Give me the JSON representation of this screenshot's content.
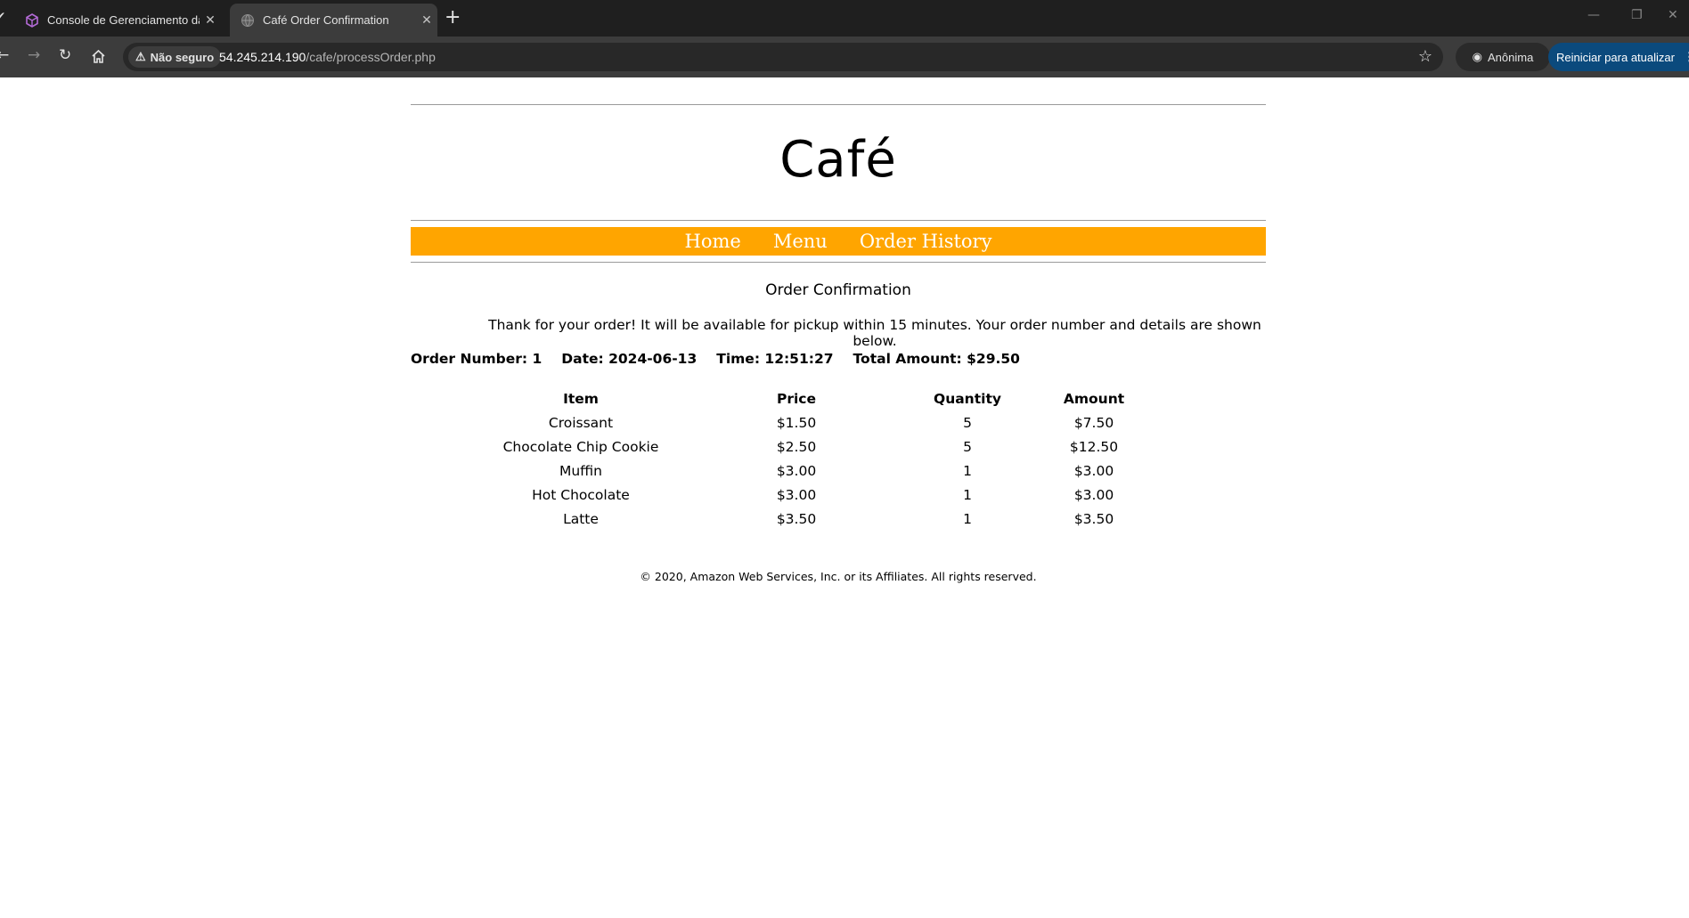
{
  "browser": {
    "tabs": [
      {
        "title": "Console de Gerenciamento da AWS",
        "active": false,
        "favicon": "cube-icon"
      },
      {
        "title": "Café Order Confirmation",
        "active": true,
        "favicon": "globe-icon"
      }
    ],
    "security_label": "Não seguro",
    "url_host": "54.245.214.190",
    "url_path": "/cafe/processOrder.php",
    "incognito_label": "Anônima",
    "update_label": "Reiniciar para atualizar"
  },
  "site": {
    "brand": "Café",
    "nav": [
      "Home",
      "Menu",
      "Order History"
    ],
    "accent_color": "#ffa500"
  },
  "order": {
    "heading": "Order Confirmation",
    "thanks": "Thank for your order! It will be available for pickup within 15 minutes. Your order number and details are shown below.",
    "number_text": "Order Number: 1",
    "date_text": "Date: 2024-06-13",
    "time_text": "Time: 12:51:27",
    "total_text": "Total Amount: $29.50",
    "columns": [
      "Item",
      "Price",
      "Quantity",
      "Amount"
    ],
    "rows": [
      [
        "Croissant",
        "$1.50",
        "5",
        "$7.50"
      ],
      [
        "Chocolate Chip Cookie",
        "$2.50",
        "5",
        "$12.50"
      ],
      [
        "Muffin",
        "$3.00",
        "1",
        "$3.00"
      ],
      [
        "Hot Chocolate",
        "$3.00",
        "1",
        "$3.00"
      ],
      [
        "Latte",
        "$3.50",
        "1",
        "$3.50"
      ]
    ]
  },
  "footer": "© 2020, Amazon Web Services, Inc. or its Affiliates. All rights reserved."
}
